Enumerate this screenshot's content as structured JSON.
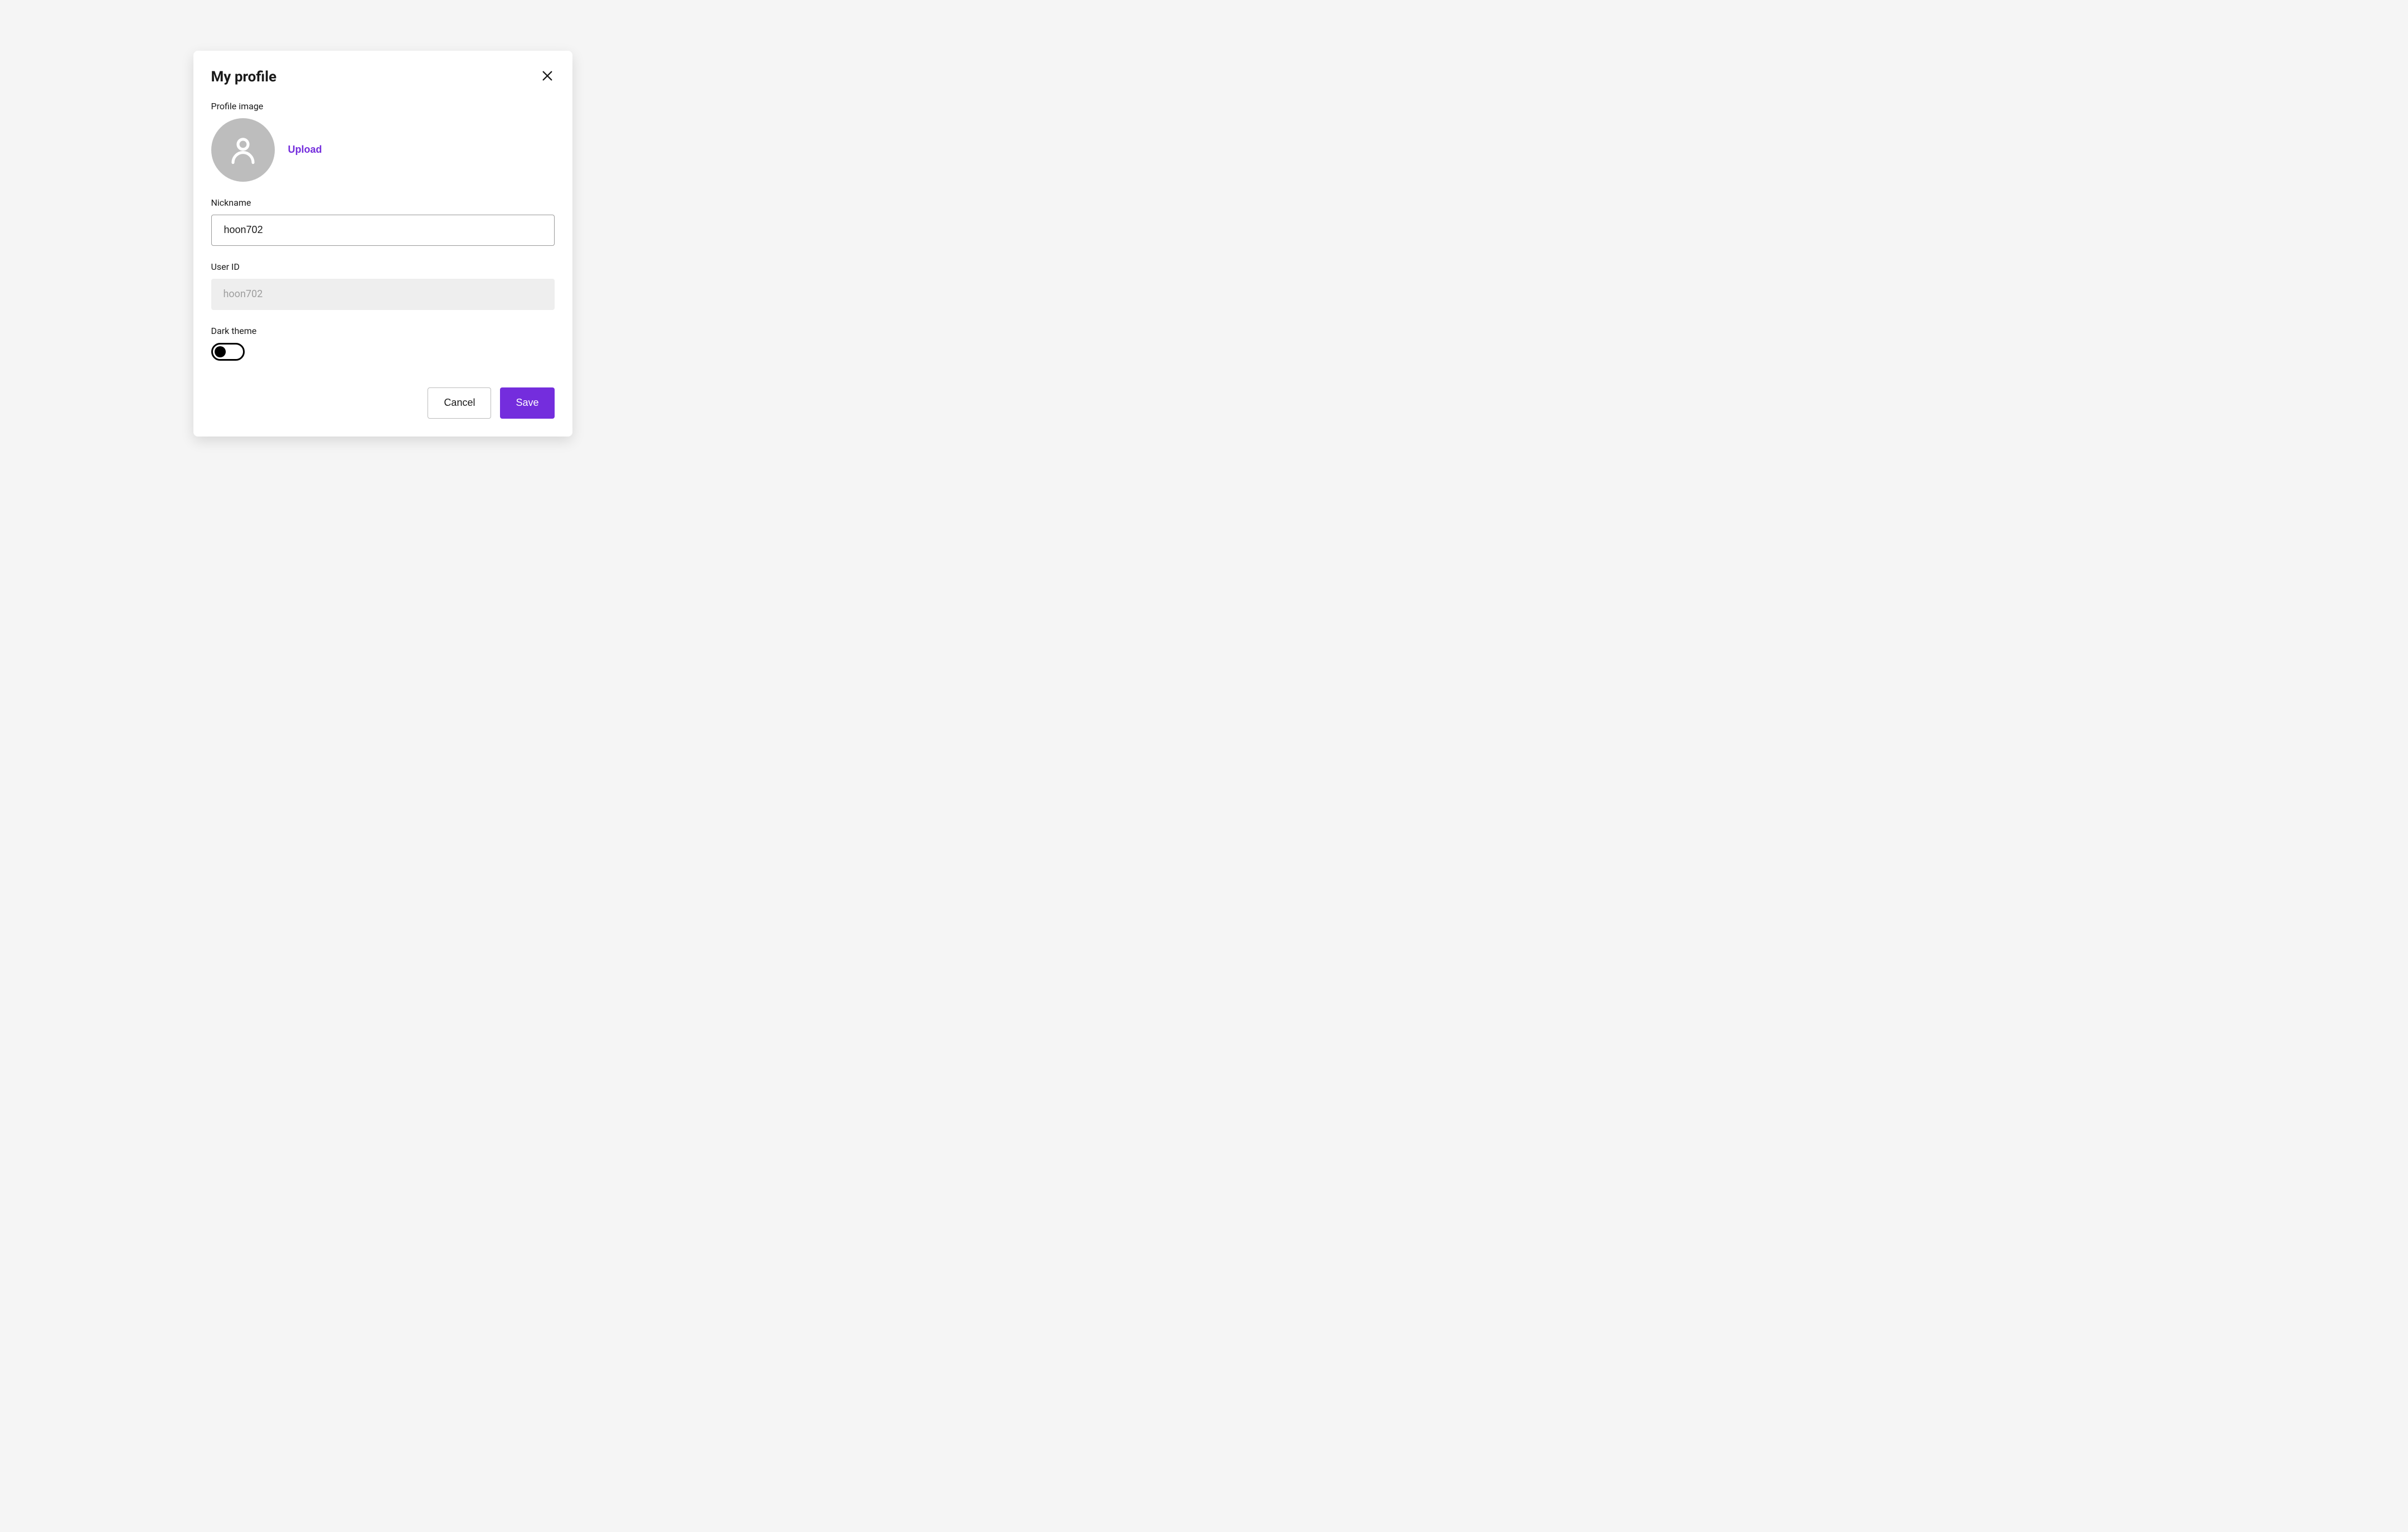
{
  "modal": {
    "title": "My profile",
    "profile_image": {
      "label": "Profile image",
      "upload_label": "Upload"
    },
    "nickname": {
      "label": "Nickname",
      "value": "hoon702"
    },
    "user_id": {
      "label": "User ID",
      "value": "hoon702"
    },
    "dark_theme": {
      "label": "Dark theme",
      "enabled": false
    },
    "actions": {
      "cancel_label": "Cancel",
      "save_label": "Save"
    }
  },
  "colors": {
    "accent": "#742ddd"
  }
}
